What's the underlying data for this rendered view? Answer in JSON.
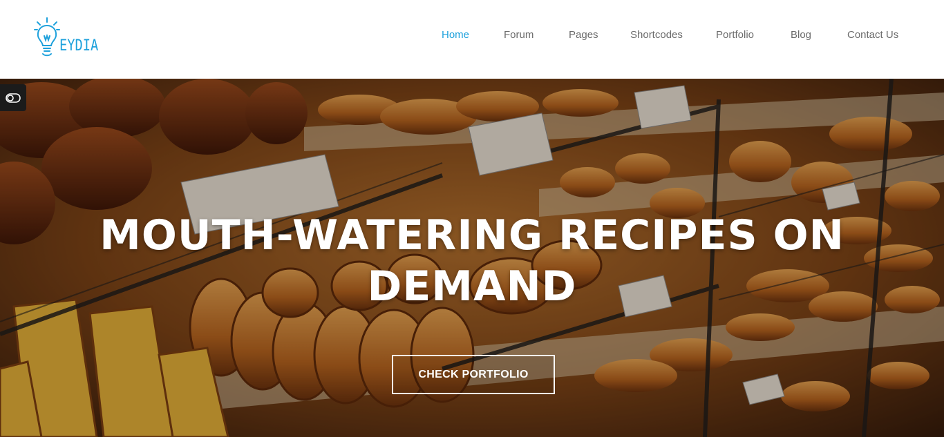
{
  "header": {
    "logo_text": "EYDIA",
    "brand_color": "#1ea1dc",
    "logo_icon": "lightbulb-icon"
  },
  "nav": {
    "items": [
      {
        "label": "Home",
        "active": true
      },
      {
        "label": "Forum",
        "active": false
      },
      {
        "label": "Pages",
        "active": false
      },
      {
        "label": "Shortcodes",
        "active": false
      },
      {
        "label": "Portfolio",
        "active": false
      },
      {
        "label": "Blog",
        "active": false
      },
      {
        "label": "Contact Us",
        "active": false
      }
    ]
  },
  "side_toggle": {
    "icon": "toggle-switch-icon"
  },
  "hero": {
    "title_line1": "MOUTH-WATERING RECIPES ON",
    "title_line2": "DEMAND",
    "cta_label": "CHECK PORTFOLIO"
  }
}
